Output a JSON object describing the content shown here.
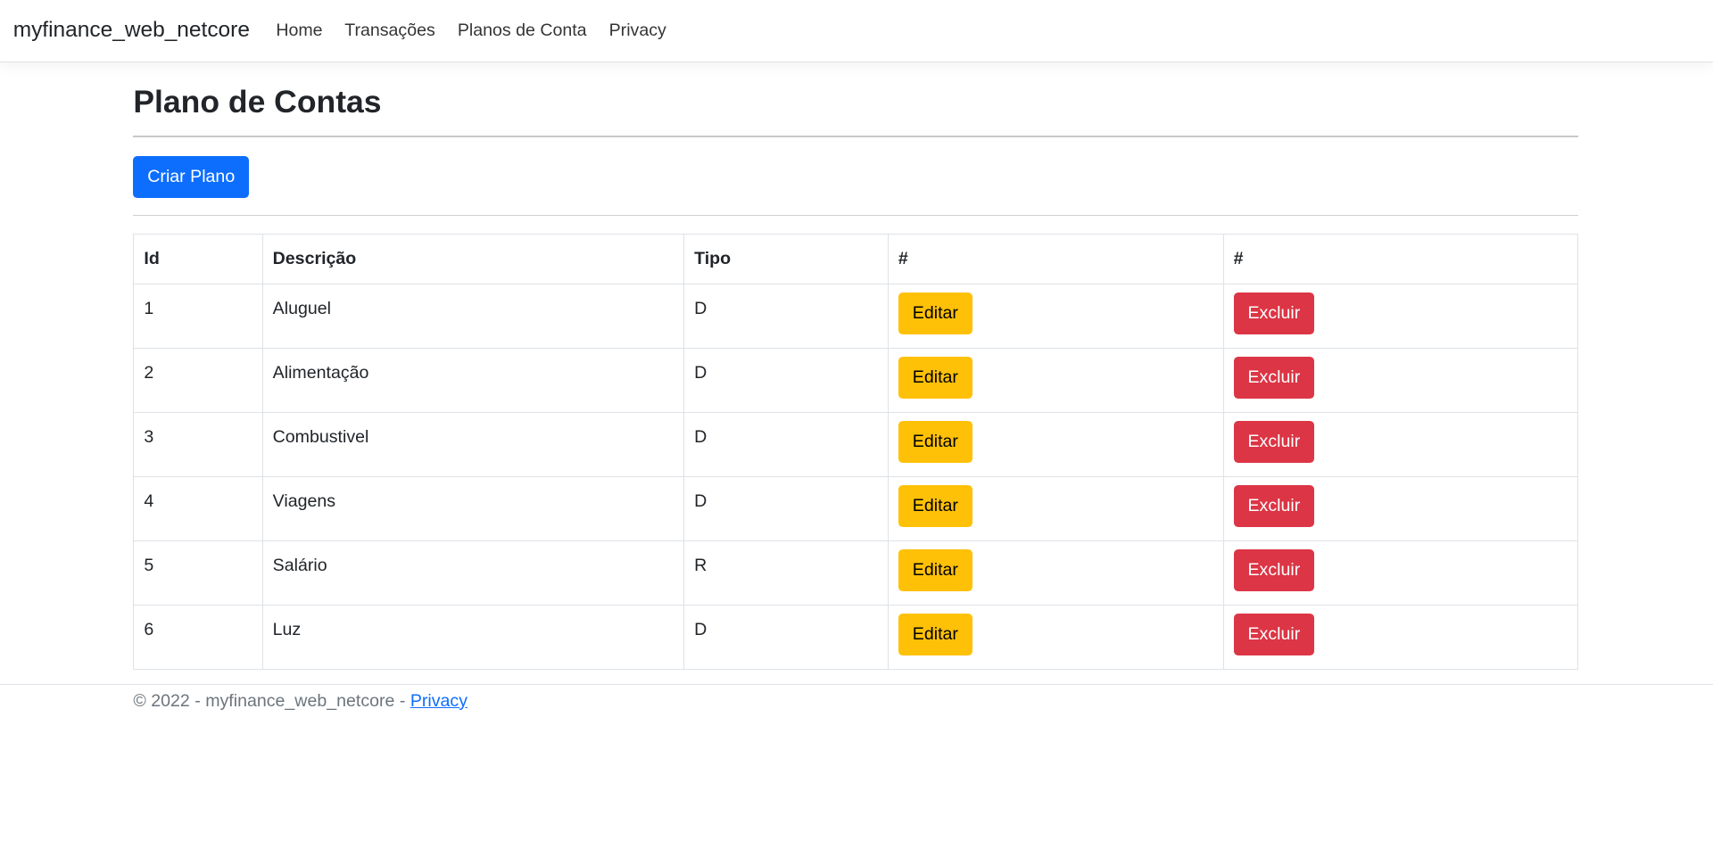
{
  "nav": {
    "brand": "myfinance_web_netcore",
    "links": [
      "Home",
      "Transações",
      "Planos de Conta",
      "Privacy"
    ]
  },
  "page": {
    "title": "Plano de Contas",
    "create_label": "Criar Plano"
  },
  "table": {
    "headers": [
      "Id",
      "Descrição",
      "Tipo",
      "#",
      "#"
    ],
    "rows": [
      {
        "id": "1",
        "desc": "Aluguel",
        "tipo": "D"
      },
      {
        "id": "2",
        "desc": "Alimentação",
        "tipo": "D"
      },
      {
        "id": "3",
        "desc": "Combustivel",
        "tipo": "D"
      },
      {
        "id": "4",
        "desc": "Viagens",
        "tipo": "D"
      },
      {
        "id": "5",
        "desc": "Salário",
        "tipo": "R"
      },
      {
        "id": "6",
        "desc": "Luz",
        "tipo": "D"
      }
    ],
    "edit_label": "Editar",
    "delete_label": "Excluir"
  },
  "footer": {
    "text": "© 2022 - myfinance_web_netcore - ",
    "link": "Privacy"
  }
}
